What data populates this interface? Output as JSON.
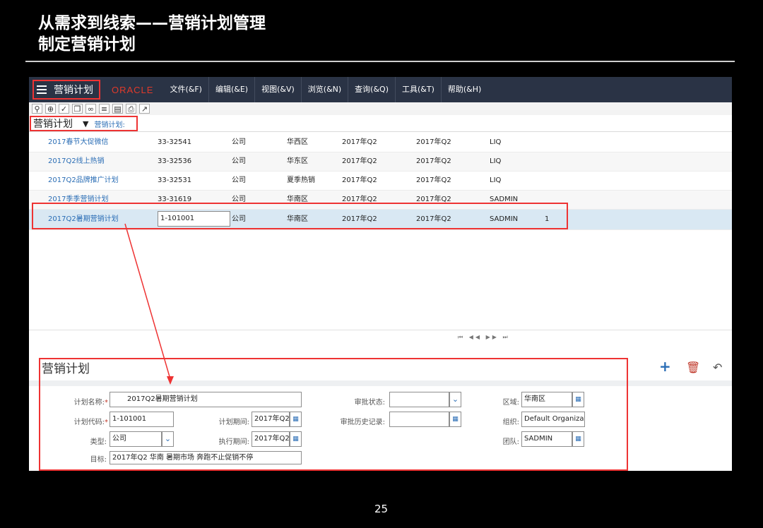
{
  "slide": {
    "title_line1": "从需求到线索——营销计划管理",
    "title_line2": "制定营销计划",
    "page_number": "25"
  },
  "menubar": {
    "app_name": "营销计划",
    "brand": "ORACLE",
    "items": [
      "文件(&F)",
      "编辑(&E)",
      "视图(&V)",
      "浏览(&N)",
      "查询(&Q)",
      "工具(&T)",
      "帮助(&H)"
    ]
  },
  "toolbar": {
    "icons": [
      "search-icon",
      "target-icon",
      "clipboard-check-icon",
      "copy-icon",
      "link-icon",
      "list-icon",
      "document-icon",
      "print-icon",
      "chart-icon"
    ]
  },
  "viewbar": {
    "view_name": "营销计划",
    "crumb": "营销计划:"
  },
  "list": {
    "rows": [
      {
        "name": "2017春节大促微信",
        "code": "33-32541",
        "type": "公司",
        "region": "华西区",
        "p1": "2017年Q2",
        "p2": "2017年Q2",
        "owner": "LIQ",
        "extra": ""
      },
      {
        "name": "2017Q2线上热销",
        "code": "33-32536",
        "type": "公司",
        "region": "华东区",
        "p1": "2017年Q2",
        "p2": "2017年Q2",
        "owner": "LIQ",
        "extra": ""
      },
      {
        "name": "2017Q2品牌推广计划",
        "code": "33-32531",
        "type": "公司",
        "region": "夏季热销",
        "p1": "2017年Q2",
        "p2": "2017年Q2",
        "owner": "LIQ",
        "extra": ""
      },
      {
        "name": "2017季季营销计划",
        "code": "33-31619",
        "type": "公司",
        "region": "华南区",
        "p1": "2017年Q2",
        "p2": "2017年Q2",
        "owner": "SADMIN",
        "extra": ""
      },
      {
        "name": "2017Q2暑期营销计划",
        "code": "1-101001",
        "type": "公司",
        "region": "华南区",
        "p1": "2017年Q2",
        "p2": "2017年Q2",
        "owner": "SADMIN",
        "extra": "1"
      }
    ],
    "pager": "⏮ ◀◀ ▶▶ ⏭"
  },
  "form": {
    "title": "营销计划",
    "plan_name_label": "计划名称:",
    "plan_name": "2017Q2暑期营销计划",
    "plan_code_label": "计划代码:",
    "plan_code": "1-101001",
    "type_label": "类型:",
    "type": "公司",
    "goal_label": "目标:",
    "goal": "2017年Q2 华南 暑期市场 奔跑不止促销不停",
    "plan_period_label": "计划期间:",
    "plan_period": "2017年Q2",
    "exec_period_label": "执行期间:",
    "exec_period": "2017年Q2",
    "approval_status_label": "审批状态:",
    "approval_status": "",
    "approval_history_label": "审批历史记录:",
    "approval_history": "",
    "region_label": "区域:",
    "region": "华南区",
    "org_label": "组织:",
    "org": "Default Organization",
    "team_label": "团队:",
    "team": "SADMIN",
    "required_mark": "*"
  },
  "colors": {
    "menubar": "#2a3345",
    "highlight": "#e33333",
    "link": "#2a6db5",
    "selected_row": "#d9e8f3"
  }
}
